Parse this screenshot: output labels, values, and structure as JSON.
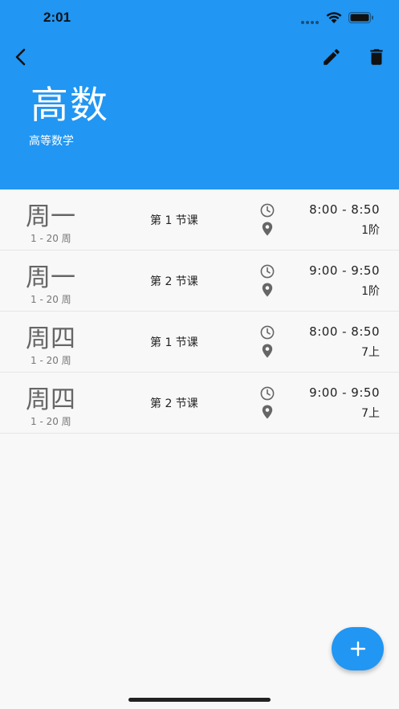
{
  "status_bar": {
    "time": "2:01"
  },
  "header": {
    "title": "高数",
    "subtitle": "高等数学",
    "background_color": "#2196f3",
    "icons": {
      "back": "back-arrow-icon",
      "edit": "pencil-icon",
      "delete": "trash-icon"
    }
  },
  "schedule": [
    {
      "day": "周一",
      "weeks": "1 - 20 周",
      "period": "第 1 节课",
      "time": "8:00 - 8:50",
      "location": "1阶"
    },
    {
      "day": "周一",
      "weeks": "1 - 20 周",
      "period": "第 2 节课",
      "time": "9:00 - 9:50",
      "location": "1阶"
    },
    {
      "day": "周四",
      "weeks": "1 - 20 周",
      "period": "第 1 节课",
      "time": "8:00 - 8:50",
      "location": "7上"
    },
    {
      "day": "周四",
      "weeks": "1 - 20 周",
      "period": "第 2 节课",
      "time": "9:00 - 9:50",
      "location": "7上"
    }
  ],
  "fab": {
    "icon": "plus-icon",
    "color": "#2196f3"
  }
}
